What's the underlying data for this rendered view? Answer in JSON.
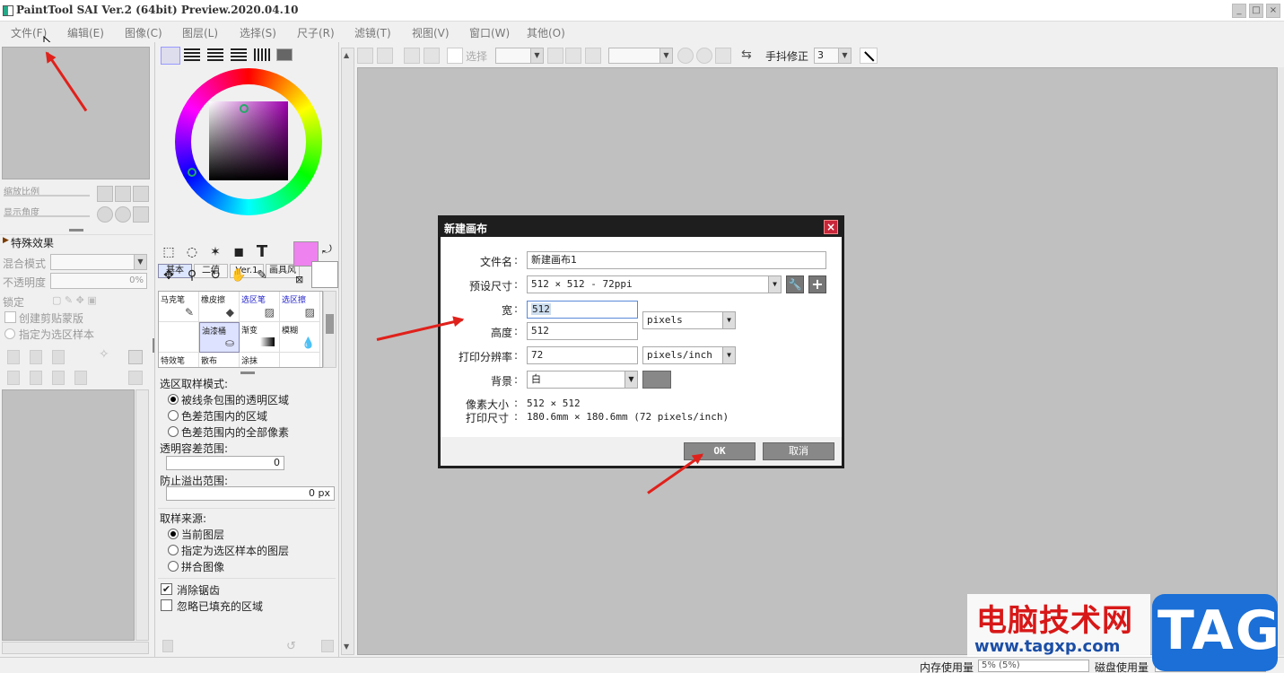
{
  "window": {
    "title": "PaintTool SAI Ver.2 (64bit) Preview.2020.04.10",
    "min": "_",
    "max": "□",
    "close": "×"
  },
  "menu": [
    "文件(F)",
    "编辑(E)",
    "图像(C)",
    "图层(L)",
    "选择(S)",
    "尺子(R)",
    "滤镜(T)",
    "视图(V)",
    "窗口(W)",
    "其他(O)"
  ],
  "navigator": {
    "zoom_label": "缩放比例",
    "angle_label": "显示角度"
  },
  "layer_props": {
    "effects_title": "特殊效果",
    "blend_label": "混合模式",
    "opacity_label": "不透明度",
    "opacity_value": "0%",
    "lock_label": "锁定",
    "clip_label": "创建剪贴蒙版",
    "selsrc_label": "指定为选区样本"
  },
  "color_tabs": [
    "基本",
    "二值",
    "Ver.1",
    "画具风"
  ],
  "brushes": [
    [
      "马克笔",
      "橡皮擦",
      "选区笔",
      "选区擦"
    ],
    [
      "",
      "油漆桶",
      "渐变",
      "模糊"
    ],
    [
      "特效笔",
      "散布",
      "涂抹",
      ""
    ]
  ],
  "fill_options": {
    "mode_title": "选区取样模式:",
    "mode_options": [
      "被线条包围的透明区域",
      "色差范围内的区域",
      "色差范围内的全部像素"
    ],
    "tol_title": "透明容差范围:",
    "tol_value": "0",
    "overflow_title": "防止溢出范围:",
    "overflow_value": "0 px",
    "source_title": "取样来源:",
    "source_options": [
      "当前图层",
      "指定为选区样本的图层",
      "拼合图像"
    ],
    "antialias": "消除锯齿",
    "ignore_filled": "忽略已填充的区域"
  },
  "toolbar": {
    "select_label": "选择",
    "stab_label": "手抖修正",
    "stab_value": "3"
  },
  "dialog": {
    "title": "新建画布",
    "close": "×",
    "name_label": "文件名",
    "name_value": "新建画布1",
    "preset_label": "预设尺寸",
    "preset_value": "512 × 512 - 72ppi",
    "width_label": "宽",
    "width_value": "512",
    "height_label": "高度",
    "height_value": "512",
    "unit_value": "pixels",
    "res_label": "打印分辨率",
    "res_value": "72",
    "res_unit_value": "pixels/inch",
    "bg_label": "背景",
    "bg_value": "白",
    "pixel_size_label": "像素大小",
    "pixel_size_value": "512 × 512",
    "print_size_label": "打印尺寸",
    "print_size_value": "180.6mm × 180.6mm (72 pixels/inch)",
    "ok": "OK",
    "cancel": "取消"
  },
  "status": {
    "memory_label": "内存使用量",
    "memory_value": "5% (5%)",
    "disk_label": "磁盘使用量"
  },
  "watermark": {
    "text": "电脑技术网",
    "url": "www.tagxp.com",
    "logo": "TAG"
  },
  "colors": {
    "accent_red": "#e0211b",
    "primary_color": "#ee82ee",
    "dialog_head": "#1e1e1e",
    "logo_blue": "#1b6fd6"
  }
}
